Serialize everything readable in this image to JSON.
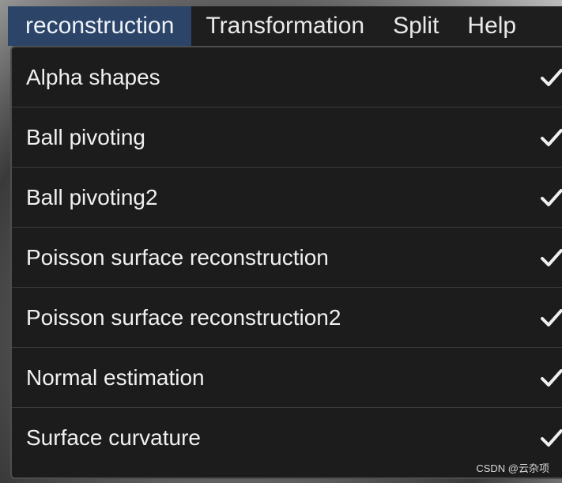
{
  "menubar": {
    "items": [
      {
        "label": "reconstruction",
        "active": true
      },
      {
        "label": "Transformation"
      },
      {
        "label": "Split"
      },
      {
        "label": "Help"
      }
    ]
  },
  "menu": {
    "items": [
      {
        "label": "Alpha shapes",
        "checked": true
      },
      {
        "label": "Ball pivoting",
        "checked": true
      },
      {
        "label": "Ball pivoting2",
        "checked": true
      },
      {
        "label": "Poisson surface reconstruction",
        "checked": true
      },
      {
        "label": "Poisson surface reconstruction2",
        "checked": true
      },
      {
        "label": "Normal estimation",
        "checked": true
      },
      {
        "label": "Surface curvature",
        "checked": true
      }
    ],
    "check_icon": "check-icon"
  },
  "watermark": {
    "text": "CSDN @云杂项"
  },
  "colors": {
    "menubar_bg": "#1e1e1e",
    "active_tab_bg": "#2b4468",
    "menu_bg": "#1c1c1c",
    "text": "#f0f0f0"
  }
}
